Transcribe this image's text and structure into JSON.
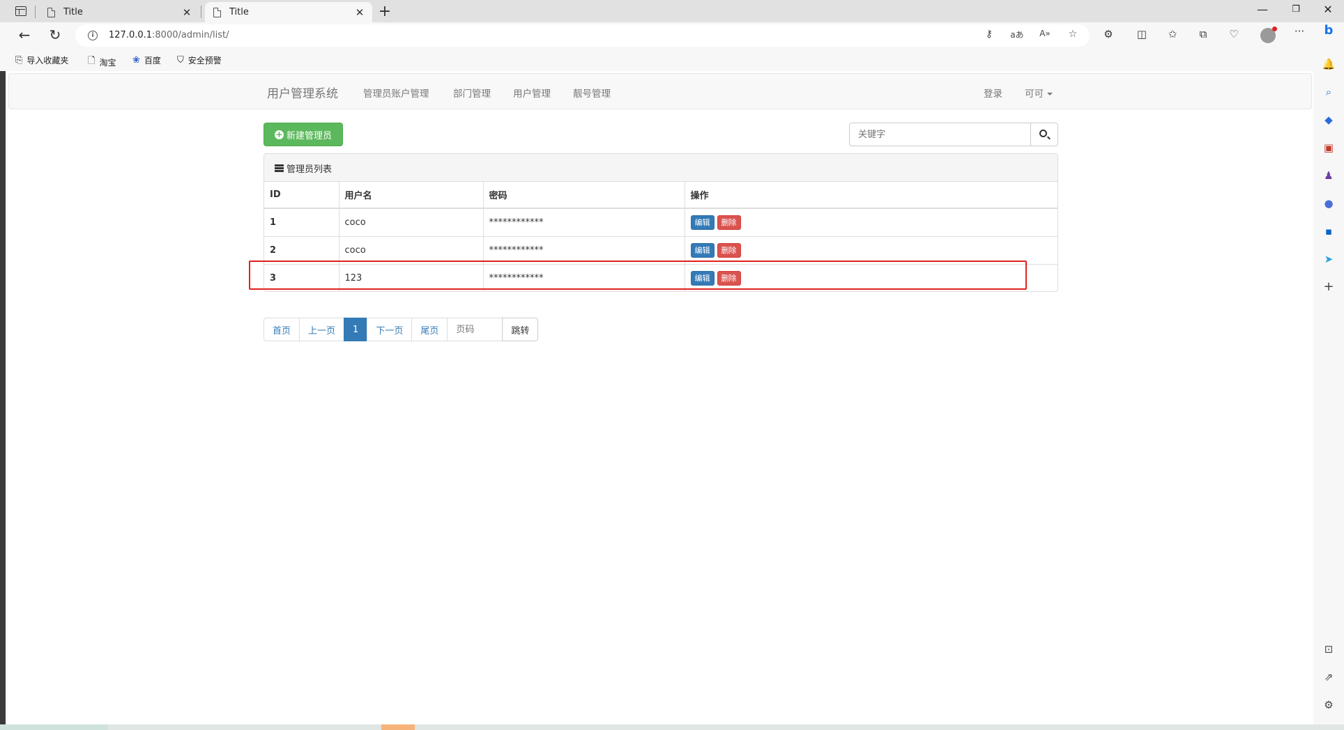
{
  "browser": {
    "tabs": [
      {
        "title": "Title",
        "active": false
      },
      {
        "title": "Title",
        "active": true
      }
    ],
    "url_host": "127.0.0.1",
    "url_rest": ":8000/admin/list/",
    "bookmarks": [
      {
        "label": "导入收藏夹",
        "icon": "import-icon"
      },
      {
        "label": "淘宝",
        "icon": "page-icon"
      },
      {
        "label": "百度",
        "icon": "baidu-paw-icon"
      },
      {
        "label": "安全预警",
        "icon": "shield-icon"
      }
    ]
  },
  "navbar": {
    "brand": "用户管理系统",
    "links": [
      "管理员账户管理",
      "部门管理",
      "用户管理",
      "靓号管理"
    ],
    "login": "登录",
    "user": "可可"
  },
  "toolbar": {
    "add_label": "新建管理员",
    "search_placeholder": "关键字"
  },
  "panel": {
    "title": "管理员列表",
    "columns": [
      "ID",
      "用户名",
      "密码",
      "操作"
    ],
    "rows": [
      {
        "id": "1",
        "username": "coco",
        "password": "************"
      },
      {
        "id": "2",
        "username": "coco",
        "password": "************"
      },
      {
        "id": "3",
        "username": "123",
        "password": "************"
      }
    ],
    "edit_label": "编辑",
    "delete_label": "删除"
  },
  "pagination": {
    "first": "首页",
    "prev": "上一页",
    "current": "1",
    "next": "下一页",
    "last": "尾页",
    "page_placeholder": "页码",
    "go": "跳转"
  },
  "colors": {
    "primary": "#337ab7",
    "success": "#5cb85c",
    "danger": "#d9534f",
    "highlight": "#e02020"
  }
}
